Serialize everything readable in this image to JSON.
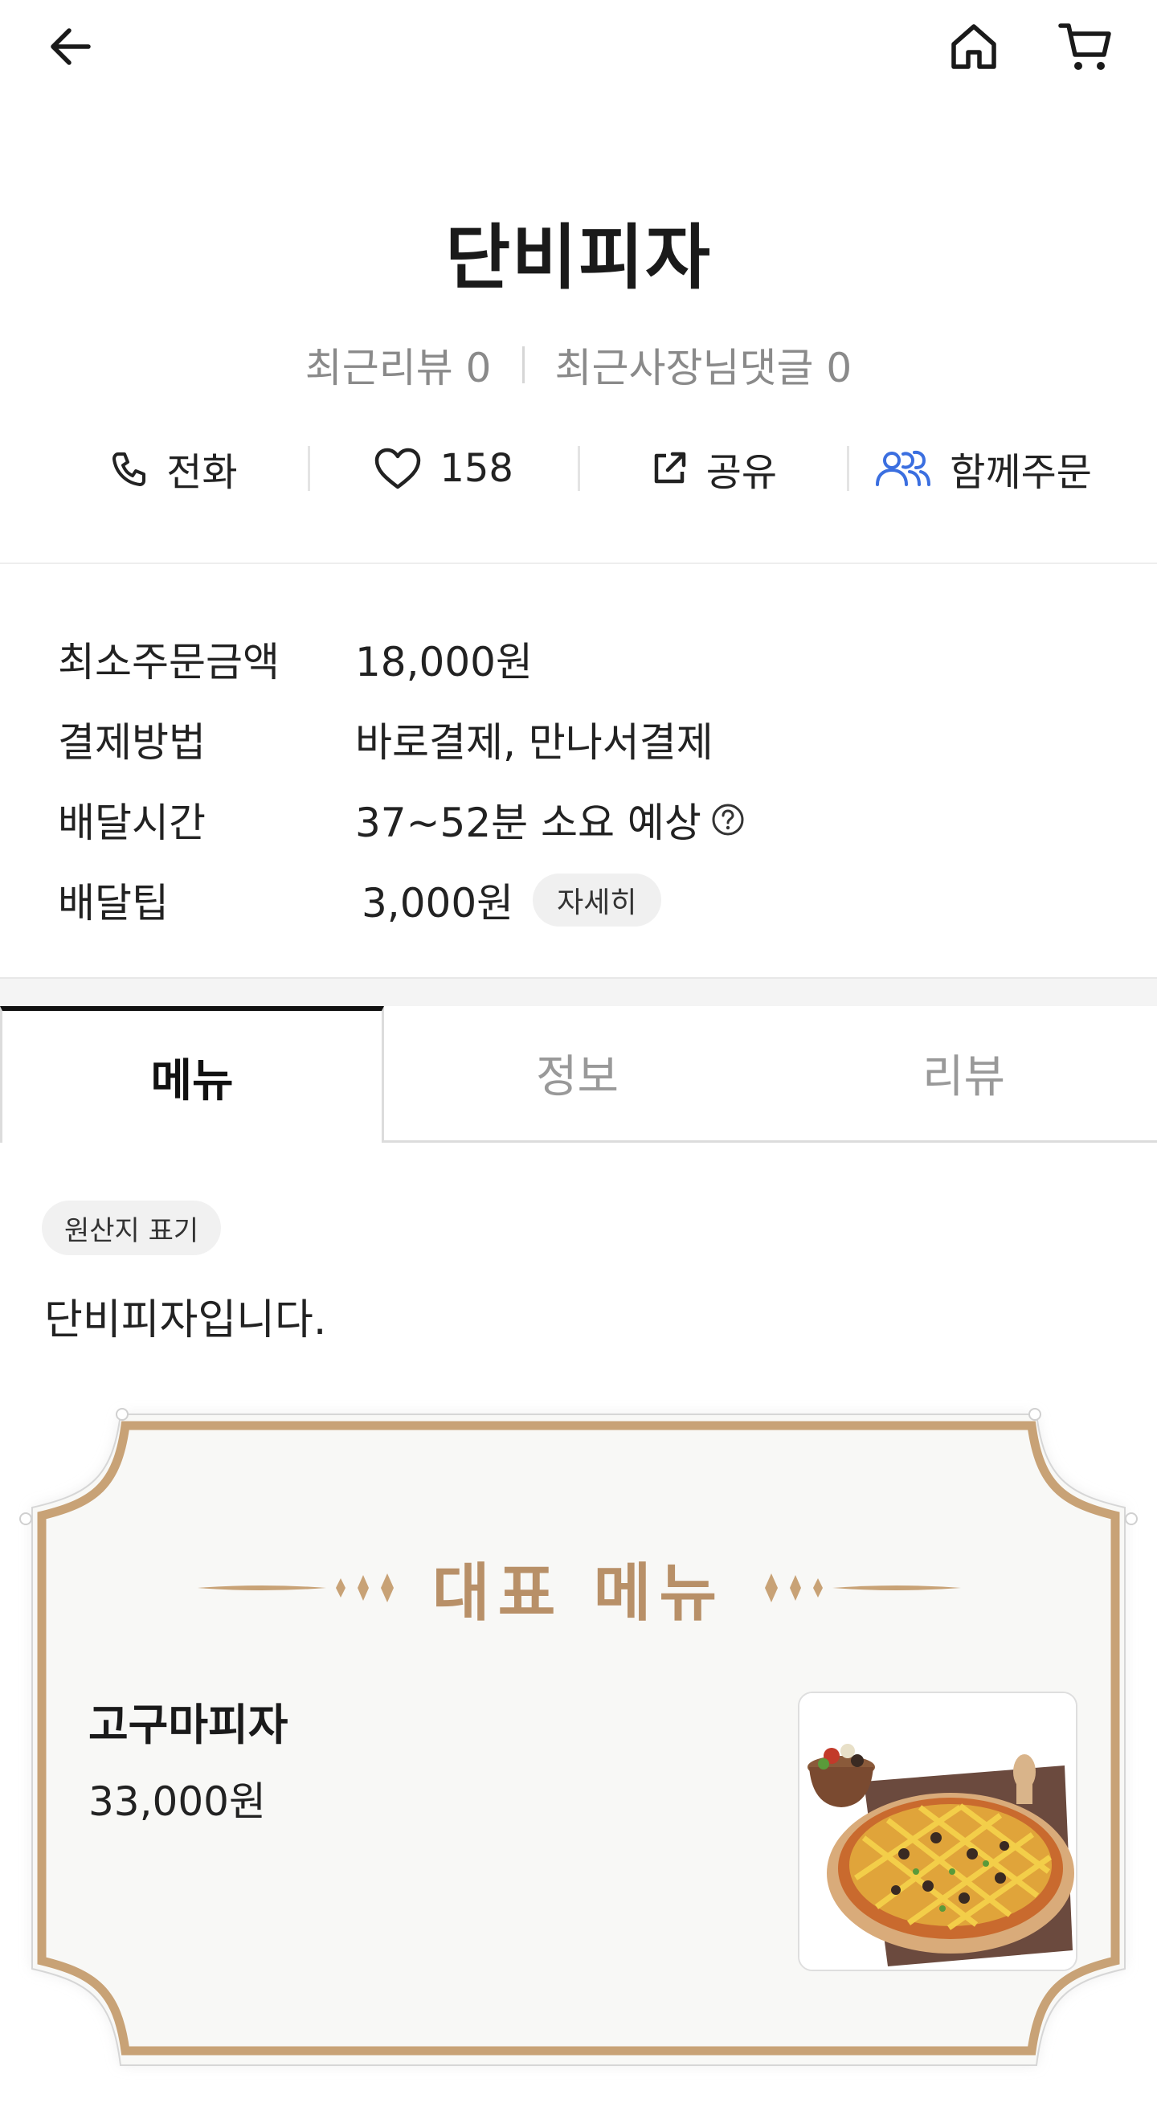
{
  "icons": {
    "back": "arrow-left-icon",
    "home": "home-icon",
    "cart": "cart-icon",
    "phone": "phone-icon",
    "heart": "heart-icon",
    "share": "share-icon",
    "group": "group-icon",
    "help": "question-circle-icon"
  },
  "store": {
    "name": "단비피자",
    "recent_reviews": "최근리뷰 0",
    "recent_owner_replies": "최근사장님댓글 0"
  },
  "actions": {
    "call": "전화",
    "likes": "158",
    "share": "공유",
    "group_order": "함께주문"
  },
  "info": {
    "min_order_label": "최소주문금액",
    "min_order_value": "18,000원",
    "payment_label": "결제방법",
    "payment_value": "바로결제, 만나서결제",
    "delivery_time_label": "배달시간",
    "delivery_time_value": "37~52분 소요 예상",
    "delivery_tip_label": "배달팁",
    "delivery_tip_value": "3,000원",
    "detail_button": "자세히"
  },
  "tabs": {
    "menu": "메뉴",
    "info": "정보",
    "review": "리뷰",
    "active": "menu"
  },
  "menu": {
    "origin_chip": "원산지 표기",
    "intro": "단비피자입니다.",
    "featured_title": "대표 메뉴",
    "featured_item": {
      "name": "고구마피자",
      "price": "33,000원"
    }
  },
  "colors": {
    "accent_gold": "#b89068",
    "group_icon_blue": "#3b6fe0",
    "frame_border": "#c8a276"
  }
}
